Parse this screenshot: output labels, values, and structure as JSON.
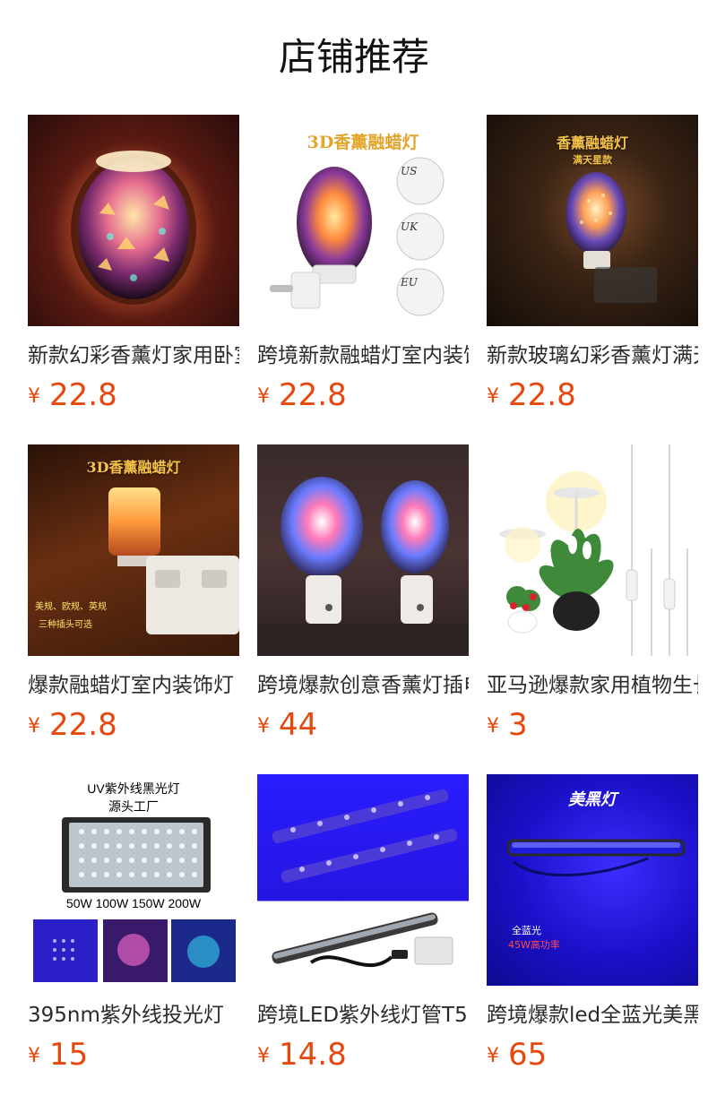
{
  "page": {
    "title": "店铺推荐"
  },
  "colors": {
    "price": "#e8470b",
    "title": "#111111",
    "name": "#2a2a2a"
  },
  "products": [
    {
      "name": "新款幻彩香薰灯家用卧室",
      "currency": "¥",
      "price": "22.8",
      "image": {
        "icon": "aroma-lamp-image",
        "caption": ""
      }
    },
    {
      "name": "跨境新款融蜡灯室内装饰",
      "currency": "¥",
      "price": "22.8",
      "image": {
        "icon": "wax-melt-lamp-image",
        "caption": "3D香薰融蜡灯",
        "plug_labels": [
          "US",
          "UK",
          "EU"
        ]
      }
    },
    {
      "name": "新款玻璃幻彩香薰灯满天星",
      "currency": "¥",
      "price": "22.8",
      "image": {
        "icon": "starry-aroma-lamp-image",
        "caption": "香薰融蜡灯",
        "subcaption": "满天星款"
      }
    },
    {
      "name": "爆款融蜡灯室内装饰灯",
      "currency": "¥",
      "price": "22.8",
      "image": {
        "icon": "square-wax-melt-lamp-image",
        "caption": "3D香薰融蜡灯",
        "note_line1": "美规、欧规、英规",
        "note_line2": "三种插头可选"
      }
    },
    {
      "name": "跨境爆款创意香薰灯插电",
      "currency": "¥",
      "price": "44",
      "image": {
        "icon": "twin-aroma-lamps-image",
        "caption": ""
      }
    },
    {
      "name": "亚马逊爆款家用植物生长灯",
      "currency": "¥",
      "price": "3",
      "image": {
        "icon": "plant-grow-light-image",
        "caption": ""
      }
    },
    {
      "name": "395nm紫外线投光灯",
      "currency": "¥",
      "price": "15",
      "image": {
        "icon": "uv-flood-light-image",
        "caption": "UV紫外线黑光灯",
        "subcaption": "源头工厂",
        "wattages": "50W  100W  150W  200W"
      }
    },
    {
      "name": "跨境LED紫外线灯管T5",
      "currency": "¥",
      "price": "14.8",
      "image": {
        "icon": "uv-tube-light-image",
        "caption": ""
      }
    },
    {
      "name": "跨境爆款led全蓝光美黑灯",
      "currency": "¥",
      "price": "65",
      "image": {
        "icon": "blue-light-bar-image",
        "caption": "美黑灯",
        "note_line1": "全蓝光",
        "note_line2": "45W高功率"
      }
    }
  ]
}
